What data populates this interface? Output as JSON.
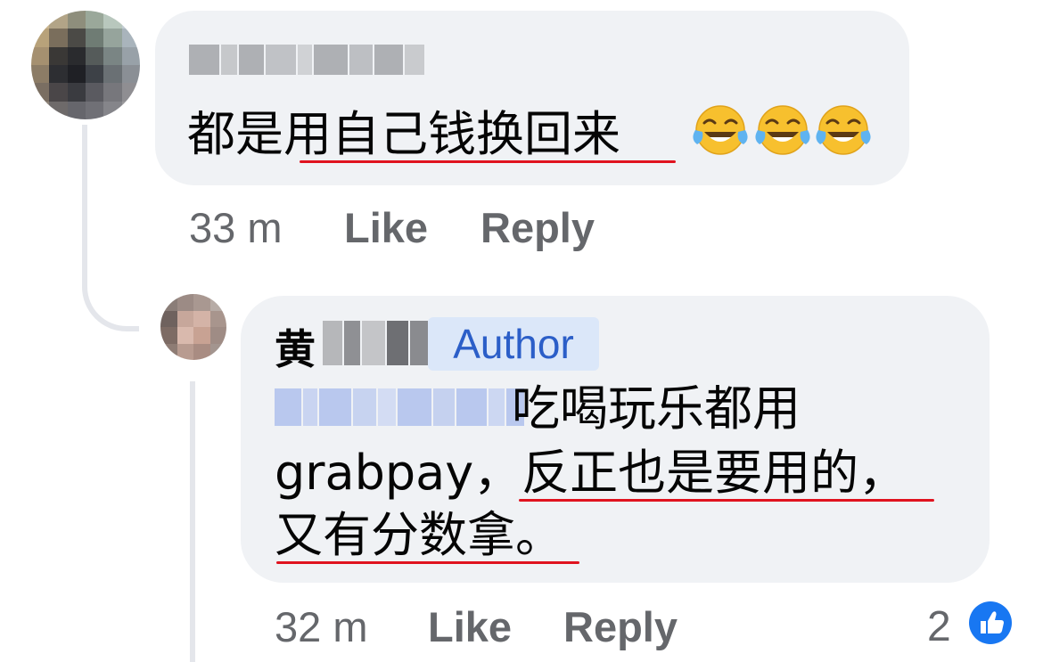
{
  "comment": {
    "text": "都是用自己钱换回来",
    "emoji_name": "face-with-tears-of-joy-icon",
    "emoji_count": 3,
    "time": "33 m",
    "like_label": "Like",
    "reply_label": "Reply"
  },
  "reply": {
    "author_surname": "黄",
    "author_badge": "Author",
    "line1": "吃喝玩乐都用",
    "line2": "grabpay，反正也是要用的，",
    "line3": "又有分数拿。",
    "time": "32 m",
    "like_label": "Like",
    "reply_label": "Reply",
    "reaction_count": "2",
    "reaction_icon": "thumbs-up-icon"
  },
  "colors": {
    "bubble": "#f0f2f5",
    "meta_text": "#65676b",
    "underline": "#e0131f",
    "author_badge_bg": "#dbe7f9",
    "author_badge_text": "#2b5ec8",
    "like_blue": "#1877f2"
  }
}
